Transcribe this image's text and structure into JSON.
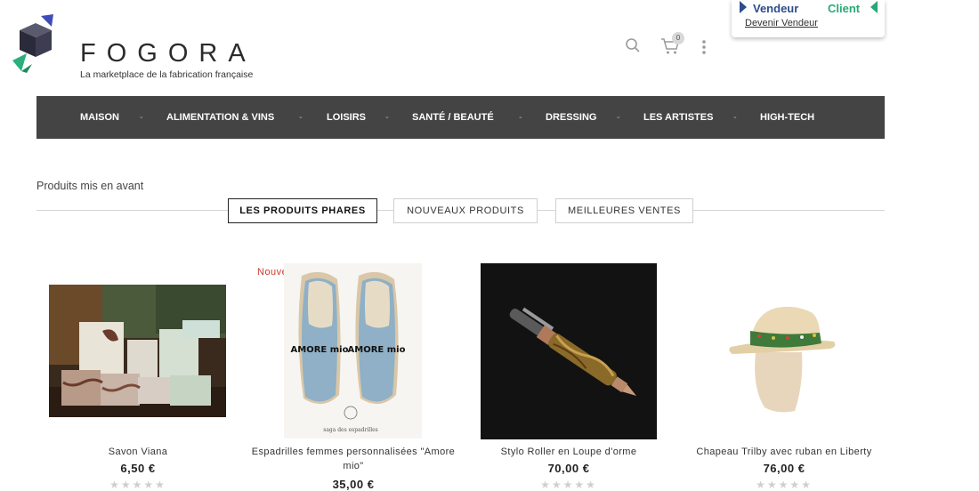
{
  "header": {
    "brand": "FOGORA",
    "tagline": "La marketplace de la fabrication française",
    "cart_count": "0"
  },
  "user_box": {
    "vendeur_label": "Vendeur",
    "client_label": "Client",
    "devenir_label": "Devenir Vendeur"
  },
  "nav": {
    "items": [
      "MAISON",
      "ALIMENTATION & VINS",
      "LOISIRS",
      "SANTÉ / BEAUTÉ",
      "DRESSING",
      "LES ARTISTES",
      "HIGH-TECH"
    ],
    "separator": "-"
  },
  "featured": {
    "title": "Produits mis en avant",
    "tabs": [
      "LES PRODUITS PHARES",
      "NOUVEAUX PRODUITS",
      "MEILLEURES VENTES"
    ],
    "active_tab": 0
  },
  "products": [
    {
      "name": "Savon Viana",
      "price": "6,50 €",
      "badge": "",
      "rating": 0
    },
    {
      "name": "Espadrilles femmes personnalisées \"Amore mio\"",
      "price": "35,00 €",
      "badge": "Nouveau",
      "rating": 0
    },
    {
      "name": "Stylo Roller en Loupe d'orme",
      "price": "70,00 €",
      "badge": "",
      "rating": 0
    },
    {
      "name": "Chapeau Trilby avec ruban en Liberty",
      "price": "76,00 €",
      "badge": "",
      "rating": 0
    }
  ],
  "images": {
    "espadrille_text": "AMORE mio",
    "espadrille_brand": "saga des espadrilles"
  },
  "colors": {
    "nav_bg": "#444444",
    "vendeur": "#2e4d8c",
    "client": "#2aa877",
    "new_badge": "#d03a2e"
  },
  "icons": [
    "search-icon",
    "cart-icon",
    "more-vertical-icon",
    "star-icon"
  ]
}
